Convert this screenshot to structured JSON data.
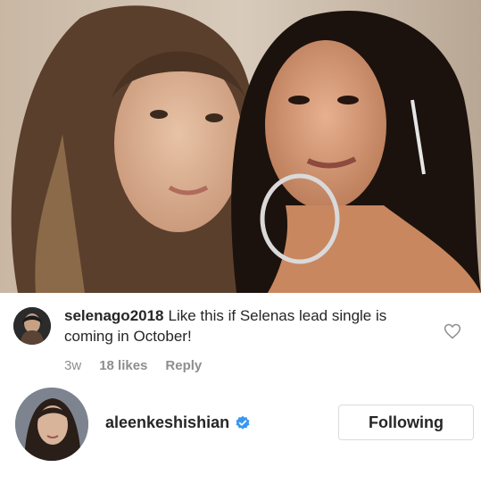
{
  "post": {
    "image_icon": "selfie-photo",
    "image_alt": ""
  },
  "comment": {
    "username": "selenago2018",
    "text": "Like this if Selenas lead single is coming in October!",
    "age": "3w",
    "likes": "18 likes",
    "reply_label": "Reply",
    "like_icon": "heart-outline-icon"
  },
  "profile": {
    "username": "aleenkeshishian",
    "verified_icon": "verified-badge-icon",
    "follow_label": "Following"
  },
  "colors": {
    "text": "#262626",
    "muted": "#8e8e8e",
    "border": "#dbdbdb",
    "verified": "#3897f0"
  }
}
